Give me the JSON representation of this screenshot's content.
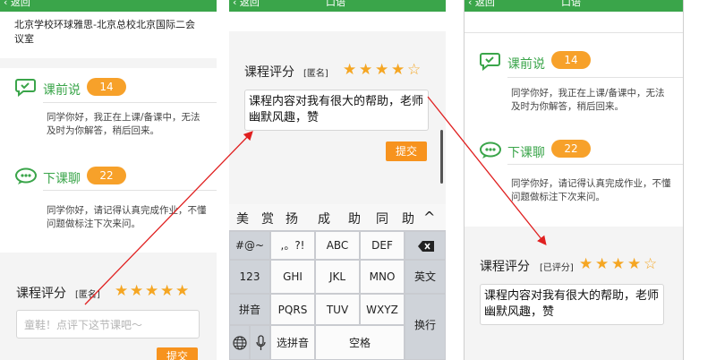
{
  "nav": {
    "back_label": "返回",
    "title": "口语"
  },
  "panel1": {
    "location": "北京学校环球雅思-北京总校北京国际二会议室",
    "before_class": {
      "label": "课前说",
      "count": "14",
      "message": "同学你好，我正在上课/备课中，无法及时为你解答，稍后回来。"
    },
    "after_class": {
      "label": "下课聊",
      "count": "22",
      "message": "同学你好，请记得认真完成作业，不懂问题做标注下次来问。"
    },
    "rating": {
      "label": "课程评分",
      "tag": "[匿名]",
      "stars_filled": 5,
      "stars_total": 5,
      "placeholder": "童鞋！点评下这节课吧～",
      "submit_label": "提交"
    }
  },
  "panel2": {
    "rating": {
      "label": "课程评分",
      "tag": "[匿名]",
      "stars_filled": 4,
      "stars_total": 5,
      "comment": "课程内容对我有很大的帮助，老师幽默风趣，赞",
      "submit_label": "提交"
    },
    "keyboard": {
      "candidates": [
        "美",
        "赏",
        "扬",
        "成",
        "助",
        "同",
        "助"
      ],
      "collapse_glyph": "^",
      "rows": [
        [
          "#@~",
          ",。?!",
          "ABC",
          "DEF",
          "delete-icon"
        ],
        [
          "123",
          "GHI",
          "JKL",
          "MNO",
          "英文"
        ],
        [
          "拼音",
          "PQRS",
          "TUV",
          "WXYZ",
          "换行"
        ],
        [
          "globe-icon",
          "mic-icon",
          "选拼音",
          "空格"
        ]
      ]
    }
  },
  "panel3": {
    "before_class": {
      "label": "课前说",
      "count": "14",
      "message": "同学你好，我正在上课/备课中，无法及时为你解答，稍后回来。"
    },
    "after_class": {
      "label": "下课聊",
      "count": "22",
      "message": "同学你好，请记得认真完成作业，不懂问题做标注下次来问。"
    },
    "rating": {
      "label": "课程评分",
      "tag": "[已评分]",
      "stars_filled": 4,
      "stars_total": 5,
      "comment": "课程内容对我有很大的帮助，老师幽默风趣，赞"
    }
  },
  "colors": {
    "green": "#3aa54a",
    "orange": "#f7a12a",
    "star": "#f5a623",
    "arrow": "#e02020"
  }
}
